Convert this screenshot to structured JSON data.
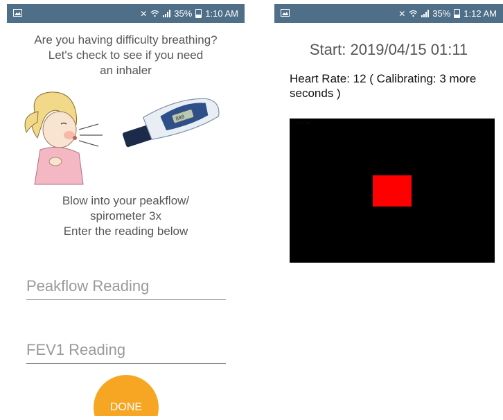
{
  "left_screen": {
    "status_bar": {
      "notification_icon": "image-notification-icon",
      "time": "1:10 AM",
      "battery": "35%",
      "icons": [
        "mute-icon",
        "wifi-icon",
        "signal-icon",
        "battery-icon"
      ]
    },
    "prompt": {
      "line1": "Are you having difficulty breathing?",
      "line2": "Let's check to see if you need",
      "line3": "an inhaler"
    },
    "illustration": "girl-blowing-into-peakflow-meter",
    "instructions": {
      "line1": "Blow into your peakflow/",
      "line2": "spirometer 3x",
      "line3": "Enter the reading below"
    },
    "peakflow_field": {
      "placeholder": "Peakflow Reading",
      "value": ""
    },
    "fev1_field": {
      "placeholder": "FEV1 Reading",
      "value": ""
    },
    "done_button": "DONE"
  },
  "right_screen": {
    "status_bar": {
      "notification_icon": "image-notification-icon",
      "time": "1:12 AM",
      "battery": "35%",
      "icons": [
        "mute-icon",
        "wifi-icon",
        "signal-icon",
        "battery-icon"
      ]
    },
    "start_label": "Start: 2019/04/15 01:11",
    "heart_rate_text": "Heart Rate: 12 ( Calibrating: 3 more seconds )",
    "camera_preview": {
      "background": "#000000",
      "marker_color": "#ff0000"
    }
  },
  "colors": {
    "status_bar": "#4f6e88",
    "accent": "#f6a623",
    "text": "#555555"
  }
}
